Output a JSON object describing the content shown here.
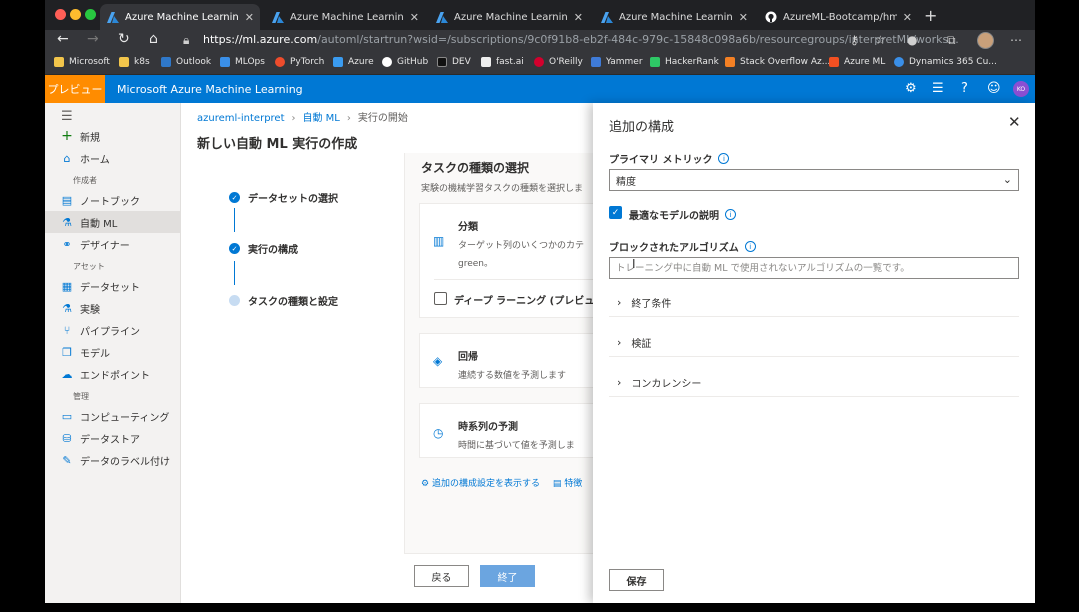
{
  "browser": {
    "tabs": [
      {
        "label": "Azure Machine Learning studio",
        "icon": "azure-ml-icon",
        "active": true
      },
      {
        "label": "Azure Machine Learning studio",
        "icon": "azure-ml-icon",
        "active": false
      },
      {
        "label": "Azure Machine Learning studio",
        "icon": "azure-ml-icon",
        "active": false
      },
      {
        "label": "Azure Machine Learning studio",
        "icon": "azure-ml-icon",
        "active": false
      },
      {
        "label": "AzureML-Bootcamp/hmeq-cla",
        "icon": "github-icon",
        "active": false
      }
    ],
    "url_host": "https://ml.azure.com",
    "url_path": "/automl/startrun?wsid=/subscriptions/9c0f91b8-eb2f-484c-979c-15848c098a6b/resourcegroups/interpretML/works...",
    "bookmarks": [
      "Microsoft",
      "k8s",
      "Outlook",
      "MLOps",
      "PyTorch",
      "Azure",
      "GitHub",
      "DEV",
      "fast.ai",
      "O'Reilly",
      "Yammer",
      "HackerRank",
      "Stack Overflow Az...",
      "Azure ML",
      "Dynamics 365 Cu..."
    ]
  },
  "header": {
    "preview_label": "プレビュー",
    "brand": "Microsoft Azure Machine Learning",
    "avatar_initials": "KO"
  },
  "nav": {
    "new": "新規",
    "home": "ホーム",
    "section_author": "作成者",
    "notebook": "ノートブック",
    "automl": "自動 ML",
    "designer": "デザイナー",
    "section_assets": "アセット",
    "datasets": "データセット",
    "experiments": "実験",
    "pipelines": "パイプライン",
    "models": "モデル",
    "endpoints": "エンドポイント",
    "section_manage": "管理",
    "compute": "コンピューティング",
    "datastores": "データストア",
    "labeling": "データのラベル付け"
  },
  "main": {
    "breadcrumb": [
      "azureml-interpret",
      "自動 ML",
      "実行の開始"
    ],
    "title": "新しい自動 ML 実行の作成",
    "steps": [
      "データセットの選択",
      "実行の構成",
      "タスクの種類と設定"
    ],
    "task_title": "タスクの種類の選択",
    "task_subtitle": "実験の機械学習タスクの種類を選択しま",
    "classification_title": "分類",
    "classification_desc1": "ターゲット列のいくつかのカテ",
    "classification_desc2": "green。",
    "deep_learning": "ディープ ラーニング (プレビュー",
    "regression_title": "回帰",
    "regression_desc": "連続する数値を予測します",
    "forecast_title": "時系列の予測",
    "forecast_desc": "時間に基づいて値を予測しま",
    "more_config_link": "追加の構成設定を表示する",
    "featurization_link": "特徴",
    "back": "戻る",
    "finish": "終了"
  },
  "panel": {
    "title": "追加の構成",
    "primary_metric_label": "プライマリ メトリック",
    "primary_metric_value": "精度",
    "explain_best_model": "最適なモデルの説明",
    "blocked_algorithms_label": "ブロックされたアルゴリズム",
    "blocked_algorithms_placeholder": "トレーニング中に自動 ML で使用されないアルゴリズムの一覧です。",
    "exit_criteria": "終了条件",
    "validation": "検証",
    "concurrency": "コンカレンシー",
    "save": "保存"
  }
}
